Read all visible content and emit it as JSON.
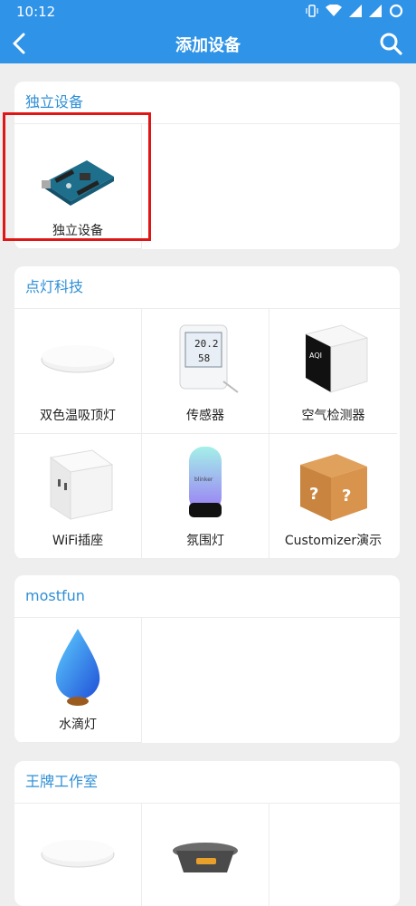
{
  "status": {
    "time": "10:12"
  },
  "appbar": {
    "title": "添加设备"
  },
  "sections": [
    {
      "title": "独立设备",
      "items": [
        {
          "label": "独立设备"
        }
      ]
    },
    {
      "title": "点灯科技",
      "items": [
        {
          "label": "双色温吸顶灯"
        },
        {
          "label": "传感器"
        },
        {
          "label": "空气检测器"
        },
        {
          "label": "WiFi插座"
        },
        {
          "label": "氛围灯"
        },
        {
          "label": "Customizer演示"
        }
      ]
    },
    {
      "title": "mostfun",
      "items": [
        {
          "label": "水滴灯"
        }
      ]
    },
    {
      "title": "王牌工作室",
      "items": [
        {
          "label": ""
        },
        {
          "label": ""
        }
      ]
    }
  ],
  "sensor_display": {
    "temp": "20.2",
    "hum": "58"
  },
  "aqi_text": "AQI",
  "ambient_text": "blinker",
  "colors": {
    "accent": "#2f93e8",
    "highlight": "#e01515"
  }
}
